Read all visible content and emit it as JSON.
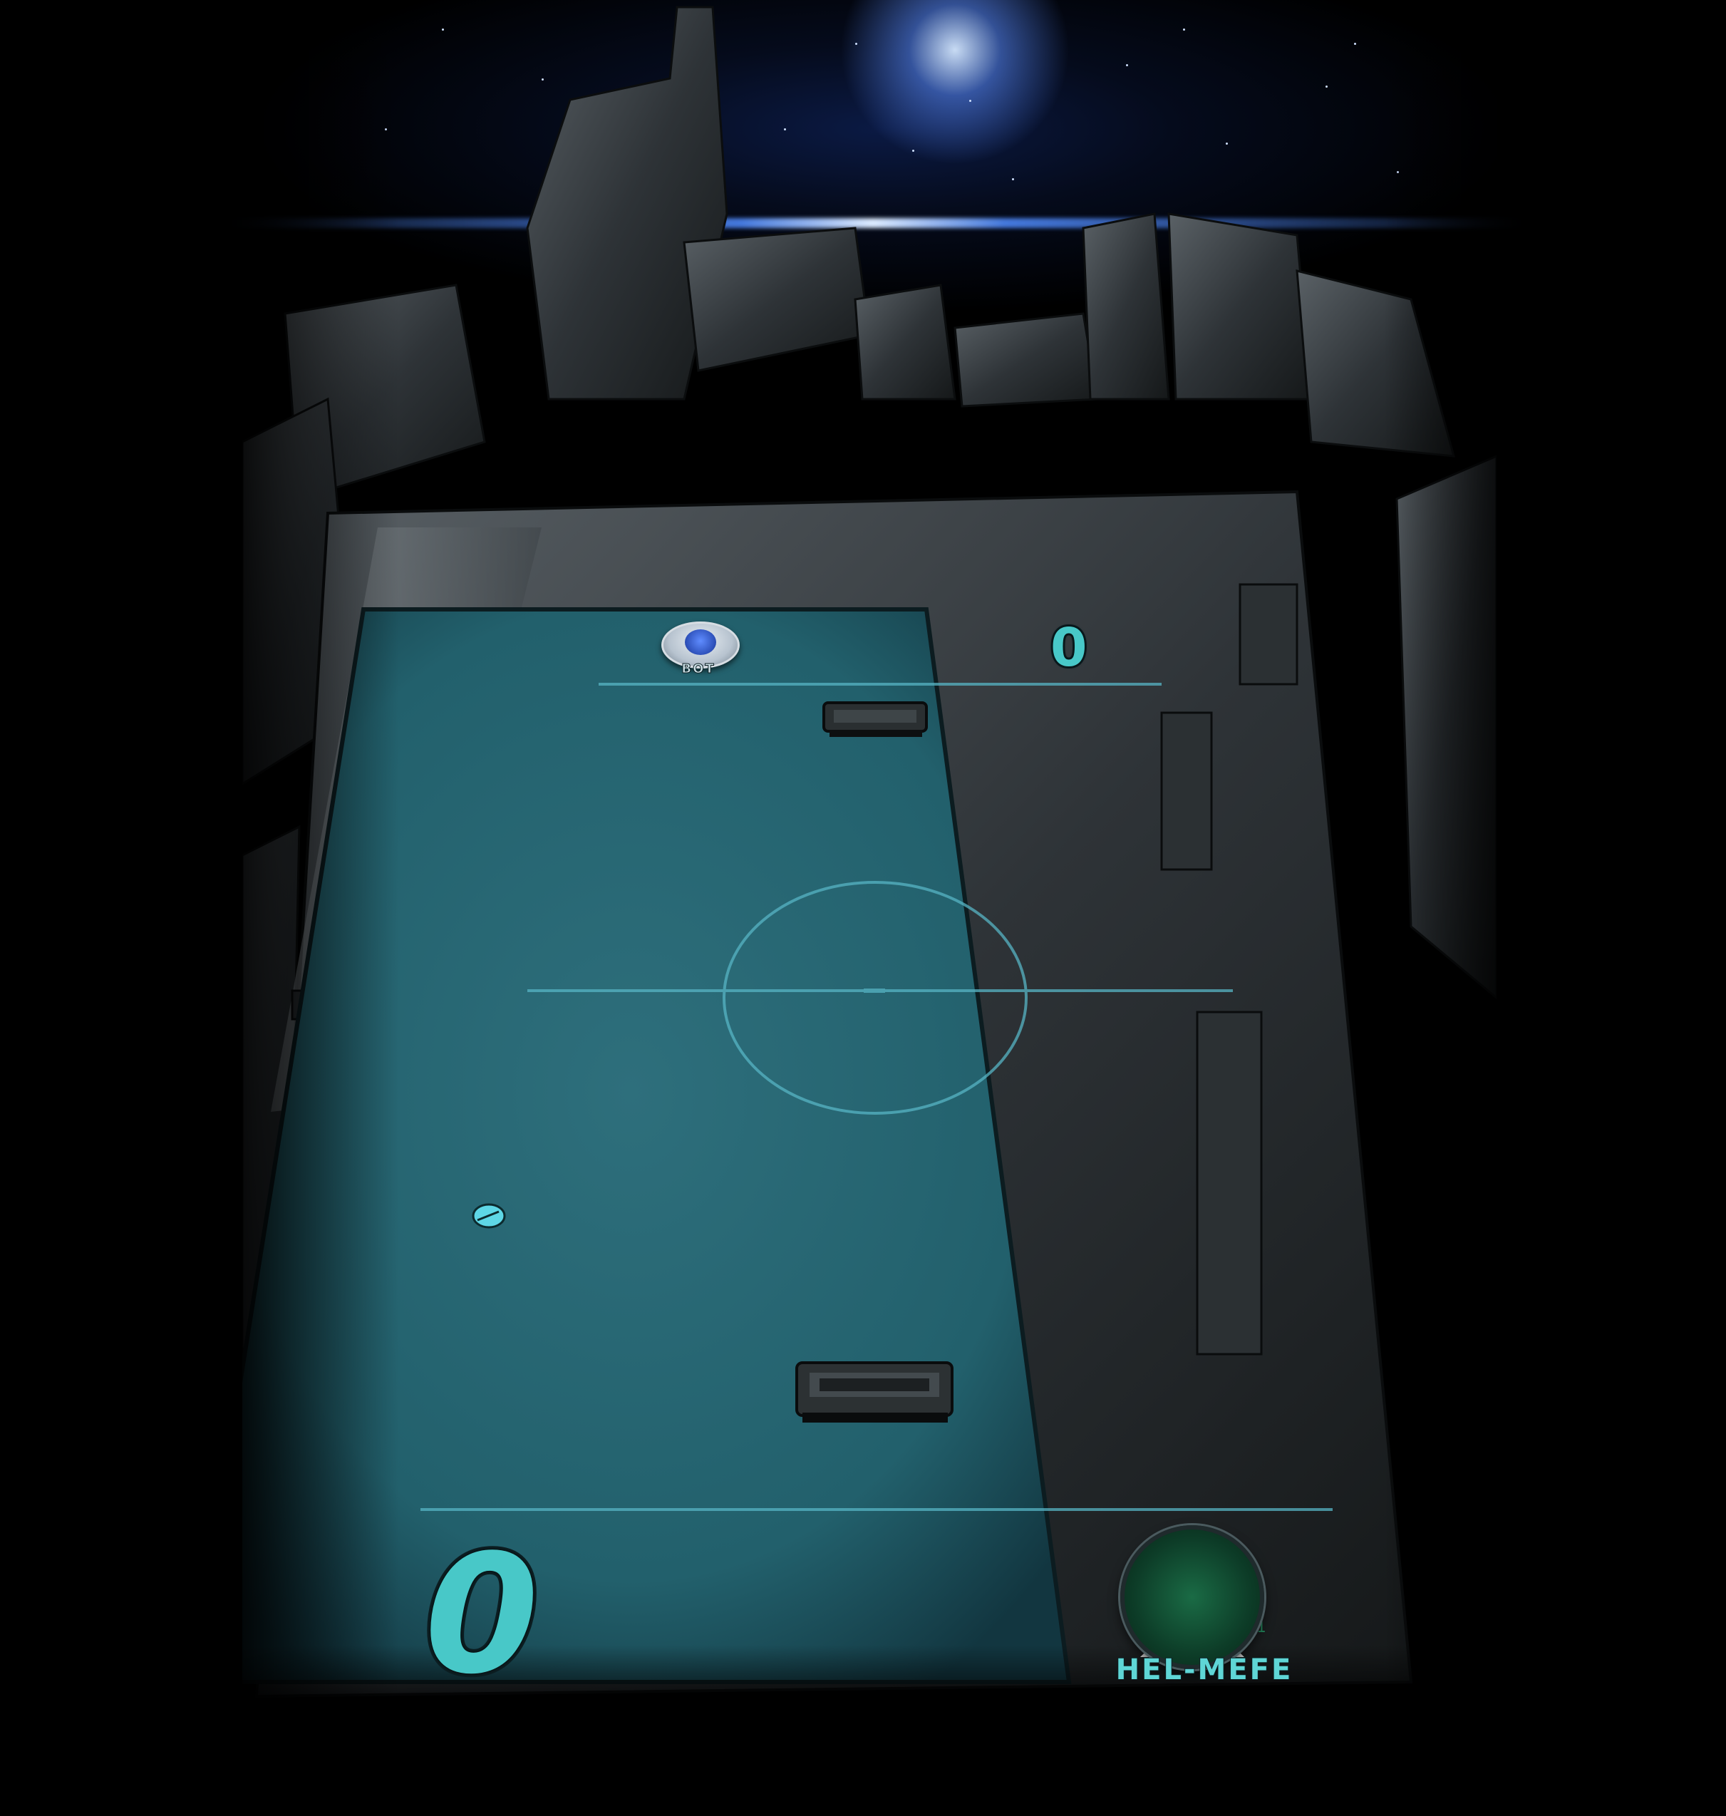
{
  "opponent": {
    "name": "BOT",
    "score": "0"
  },
  "player": {
    "name": "HEL-MEFE",
    "score": "0"
  },
  "colors": {
    "field": "#2c6b78",
    "field_line": "#57b4c4",
    "score_text": "#48c8c8",
    "name_text": "#5fd6d6"
  },
  "icons": {
    "opponent_avatar": "robot-avatar-icon",
    "player_avatar": "player-photo-avatar",
    "ball": "puck-ball-icon"
  }
}
